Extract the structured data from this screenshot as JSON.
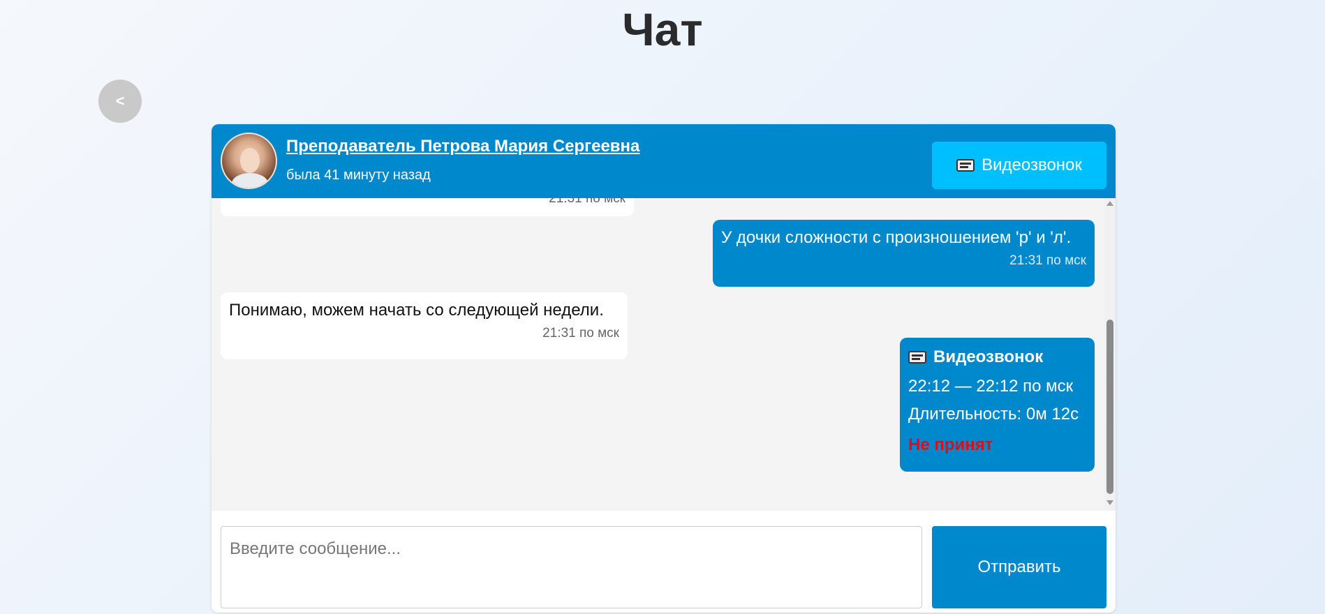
{
  "page": {
    "title": "Чат"
  },
  "nav": {
    "back_label": "<"
  },
  "header": {
    "contact_name": "Преподаватель Петрова Мария Сергеевна",
    "contact_status": "была 41 минуту назад",
    "video_call_label": "Видеозвонок",
    "video_call_icon": "camera-icon"
  },
  "messages": [
    {
      "direction": "incoming",
      "text": "",
      "time": "21:31 по мск"
    },
    {
      "direction": "outgoing",
      "text": "У дочки сложности с произношением 'р' и 'л'.",
      "time": "21:31 по мск"
    },
    {
      "direction": "incoming",
      "text": "Понимаю, можем начать со следующей недели.",
      "time": "21:31 по мск"
    }
  ],
  "call_card": {
    "icon": "camera-icon",
    "title": "Видеозвонок",
    "time_range": "22:12 — 22:12 по мск",
    "duration": "Длительность: 0м 12с",
    "status": "Не принят",
    "status_color": "#d8101e"
  },
  "composer": {
    "placeholder": "Введите сообщение...",
    "value": "",
    "send_label": "Отправить"
  },
  "colors": {
    "accent": "#0088cc",
    "video_button": "#00bfff",
    "back_button": "#c9c9c9"
  }
}
